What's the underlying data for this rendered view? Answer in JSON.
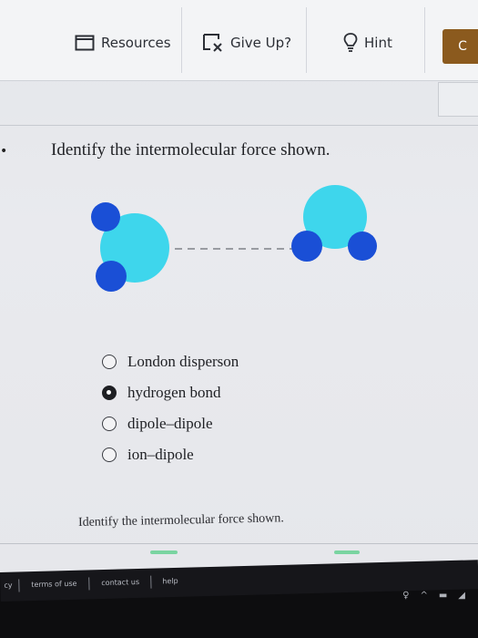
{
  "toolbar": {
    "resources": {
      "label": "Resources",
      "icon": "square-icon"
    },
    "give_up": {
      "label": "Give Up?",
      "icon": "give-up-icon"
    },
    "hint": {
      "label": "Hint",
      "icon": "lightbulb-icon"
    },
    "continue": {
      "label": "C"
    }
  },
  "question": {
    "prompt": "Identify the intermolecular force shown.",
    "options": [
      {
        "label": "London disperson",
        "selected": false
      },
      {
        "label": "hydrogen bond",
        "selected": true
      },
      {
        "label": "dipole–dipole",
        "selected": false
      },
      {
        "label": "ion–dipole",
        "selected": false
      }
    ],
    "prompt_repeat": "Identify the intermolecular force shown."
  },
  "diagram": {
    "molecules": 2,
    "colors": {
      "oxygen": "#3ed6ec",
      "hydrogen": "#1a4fd6",
      "bond": "#6a6d74"
    }
  },
  "footer": {
    "links": [
      "cy",
      "terms of use",
      "contact us",
      "help"
    ]
  },
  "colors": {
    "accent": "#8b5a1e",
    "selected_radio": "#1e1f23"
  }
}
